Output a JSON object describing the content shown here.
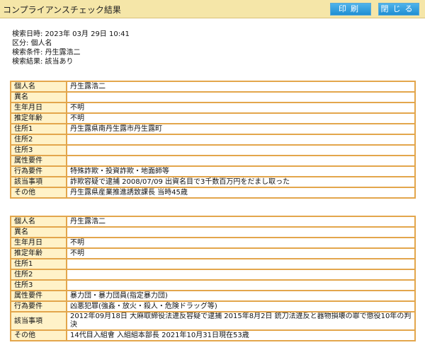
{
  "window": {
    "title": "コンプライアンスチェック結果",
    "print_label": "印刷",
    "close_label": "閉じる"
  },
  "search": {
    "datetime": "検索日時: 2023年 03月 29日 10:41",
    "category": "区分: 個人名",
    "condition": "検索条件: 丹生露浩二",
    "result": "検索結果: 該当あり"
  },
  "records": [
    {
      "name_label": "個人名",
      "name": "丹生露浩二",
      "alias_label": "異名",
      "alias": "",
      "dob_label": "生年月日",
      "dob": "不明",
      "age_label": "推定年齢",
      "age": "不明",
      "addr1_label": "住所1",
      "addr1": "丹生露県南丹生露市丹生露町",
      "addr2_label": "住所2",
      "addr2": "",
      "addr3_label": "住所3",
      "addr3": "",
      "attr_label": "属性要件",
      "attr": "",
      "conduct_label": "行為要件",
      "conduct": "特殊詐欺・投資詐欺・地面師等",
      "matter_label": "該当事項",
      "matter": "詐欺容疑で逮捕 2008/07/09 出資名目で3千数百万円をだまし取った",
      "other_label": "その他",
      "other": "丹生露県産業推進誘致課長 当時45歳"
    },
    {
      "name_label": "個人名",
      "name": "丹生露浩二",
      "alias_label": "異名",
      "alias": "",
      "dob_label": "生年月日",
      "dob": "不明",
      "age_label": "推定年齢",
      "age": "不明",
      "addr1_label": "住所1",
      "addr1": "",
      "addr2_label": "住所2",
      "addr2": "",
      "addr3_label": "住所3",
      "addr3": "",
      "attr_label": "属性要件",
      "attr": "暴力団・暴力団員(指定暴力団)",
      "conduct_label": "行為要件",
      "conduct": "凶悪犯罪(強姦・放火・殺人・危険ドラッグ等)",
      "matter_label": "該当事項",
      "matter": "2012年09月18日 大麻取締役法違反容疑で逮捕 2015年8月2日 銃刀法違反と器物損壊の罪で懲役10年の判決",
      "other_label": "その他",
      "other": "14代目入組會 入組組本部長 2021年10月31日現在53歳"
    }
  ]
}
